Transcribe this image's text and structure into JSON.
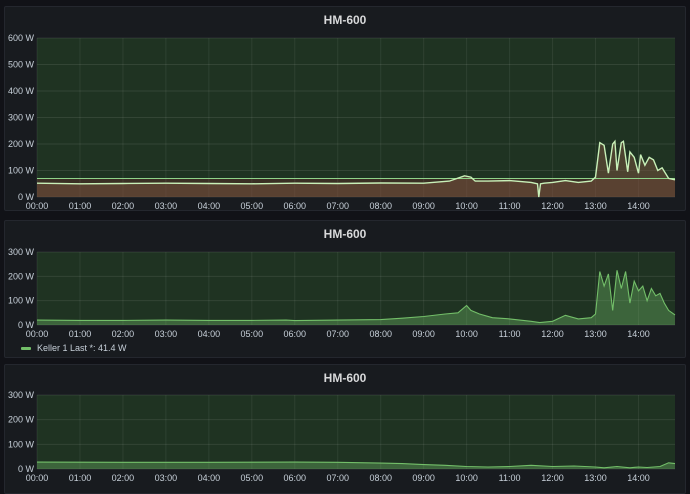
{
  "panels": [
    {
      "title": "HM-600",
      "legend": "",
      "chart_data": {
        "type": "line",
        "title": "HM-600",
        "x_ticks": [
          "00:00",
          "01:00",
          "02:00",
          "03:00",
          "04:00",
          "05:00",
          "06:00",
          "07:00",
          "08:00",
          "09:00",
          "10:00",
          "11:00",
          "12:00",
          "13:00",
          "14:00"
        ],
        "y_ticks": [
          "0 W",
          "100 W",
          "200 W",
          "300 W",
          "400 W",
          "500 W",
          "600 W"
        ],
        "ylim": [
          0,
          600
        ],
        "xlim_hours": [
          0,
          14.85
        ],
        "threshold": 70,
        "series": [
          {
            "x": [
              0,
              1,
              2,
              3,
              4,
              5,
              6,
              7,
              8,
              9,
              9.6,
              9.95,
              10.1,
              10.2,
              10.5,
              11,
              11.5,
              11.65,
              11.68,
              11.72,
              11.8,
              12,
              12.3,
              12.6,
              12.9,
              13.0,
              13.1,
              13.2,
              13.3,
              13.4,
              13.45,
              13.5,
              13.6,
              13.65,
              13.75,
              13.8,
              13.9,
              14.0,
              14.05,
              14.15,
              14.25,
              14.35,
              14.45,
              14.55,
              14.7,
              14.85
            ],
            "y": [
              52,
              50,
              51,
              52,
              51,
              50,
              52,
              51,
              53,
              52,
              60,
              80,
              75,
              60,
              60,
              62,
              55,
              50,
              0,
              50,
              52,
              55,
              62,
              55,
              60,
              75,
              205,
              195,
              90,
              200,
              210,
              100,
              205,
              210,
              95,
              170,
              150,
              90,
              160,
              120,
              150,
              140,
              100,
              110,
              70,
              65
            ]
          }
        ]
      }
    },
    {
      "title": "HM-600",
      "legend": "Keller 1   Last *: 41.4 W",
      "chart_data": {
        "type": "area",
        "title": "HM-600",
        "x_ticks": [
          "00:00",
          "01:00",
          "02:00",
          "03:00",
          "04:00",
          "05:00",
          "06:00",
          "07:00",
          "08:00",
          "09:00",
          "10:00",
          "11:00",
          "12:00",
          "13:00",
          "14:00"
        ],
        "y_ticks": [
          "0 W",
          "100 W",
          "200 W",
          "300 W"
        ],
        "ylim": [
          0,
          300
        ],
        "xlim_hours": [
          0,
          14.85
        ],
        "series": [
          {
            "name": "Keller 1",
            "x": [
              0,
              1,
              2,
              3,
              4,
              5,
              5.8,
              6,
              7,
              8,
              8.5,
              9,
              9.5,
              9.8,
              10,
              10.1,
              10.3,
              10.6,
              11,
              11.5,
              11.7,
              12,
              12.3,
              12.6,
              12.9,
              13.0,
              13.1,
              13.2,
              13.3,
              13.4,
              13.5,
              13.6,
              13.7,
              13.8,
              13.9,
              14.0,
              14.1,
              14.2,
              14.3,
              14.4,
              14.5,
              14.6,
              14.7,
              14.85
            ],
            "y": [
              20,
              19,
              19,
              20,
              19,
              19,
              20,
              18,
              20,
              22,
              28,
              35,
              45,
              50,
              80,
              60,
              45,
              30,
              25,
              15,
              10,
              15,
              40,
              25,
              30,
              45,
              220,
              160,
              210,
              60,
              225,
              150,
              220,
              90,
              180,
              140,
              160,
              100,
              150,
              120,
              130,
              90,
              60,
              41.4
            ]
          }
        ]
      }
    },
    {
      "title": "HM-600",
      "legend": "",
      "chart_data": {
        "type": "area",
        "title": "HM-600",
        "x_ticks": [
          "00:00",
          "01:00",
          "02:00",
          "03:00",
          "04:00",
          "05:00",
          "06:00",
          "07:00",
          "08:00",
          "09:00",
          "10:00",
          "11:00",
          "12:00",
          "13:00",
          "14:00"
        ],
        "y_ticks": [
          "0 W",
          "100 W",
          "200 W",
          "300 W"
        ],
        "ylim": [
          0,
          300
        ],
        "xlim_hours": [
          0,
          14.85
        ],
        "series": [
          {
            "x": [
              0,
              2,
              4,
              6,
              7,
              8,
              8.5,
              9,
              9.5,
              10,
              10.5,
              11,
              11.5,
              12,
              12.5,
              13,
              13.2,
              13.5,
              13.8,
              14,
              14.2,
              14.5,
              14.7,
              14.85
            ],
            "y": [
              28,
              27,
              27,
              28,
              27,
              24,
              22,
              18,
              15,
              10,
              8,
              10,
              15,
              10,
              12,
              8,
              5,
              10,
              5,
              8,
              6,
              10,
              25,
              22
            ]
          }
        ]
      }
    }
  ]
}
